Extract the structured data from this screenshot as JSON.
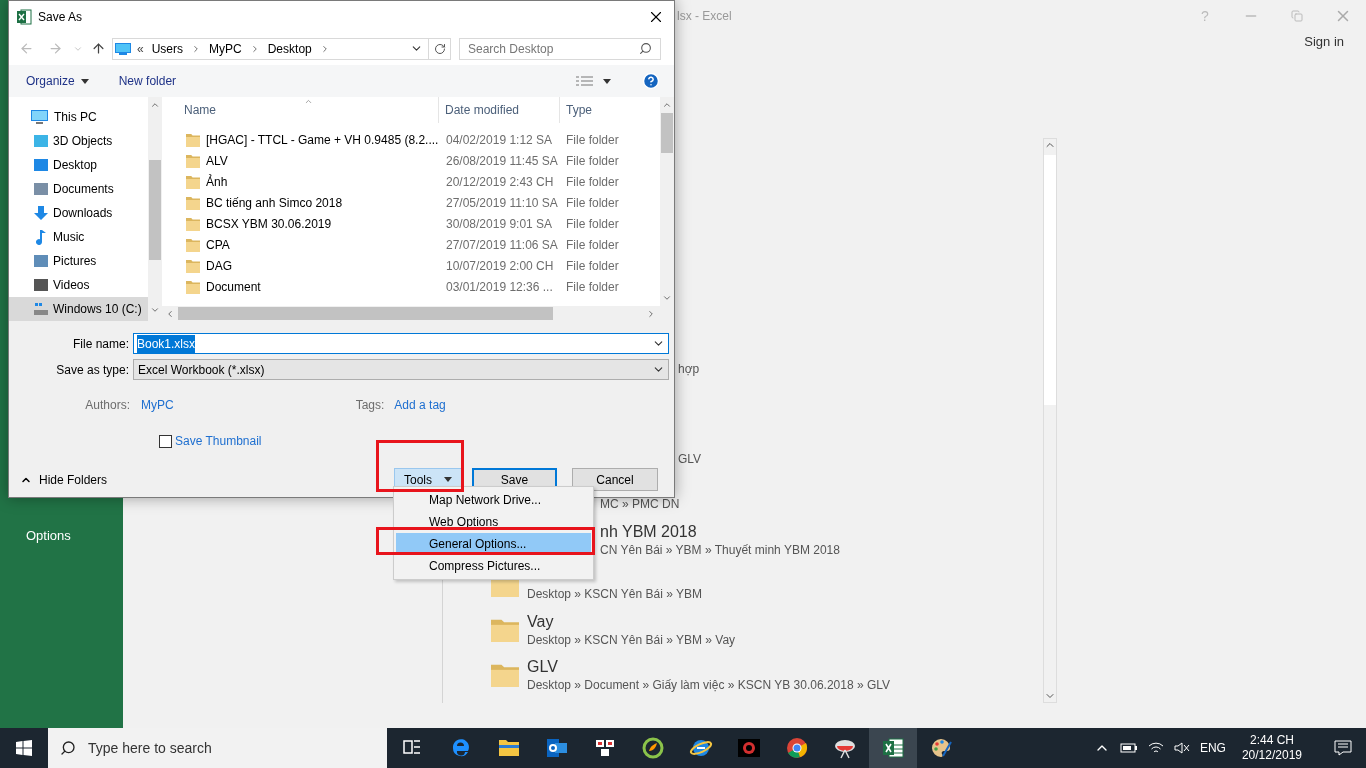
{
  "excel": {
    "title": "lsx - Excel",
    "window_controls": [
      "?"
    ],
    "sign_in": "Sign in",
    "sidebar": [
      {
        "label": "Options"
      }
    ],
    "recent": [
      {
        "kind": "edge",
        "path": "hợp"
      },
      {
        "kind": "edge",
        "path": "GLV"
      },
      {
        "kind": "tail",
        "path": "MC » PMC DN"
      },
      {
        "kind": "tail",
        "name": "nh YBM 2018",
        "path": "CN Yên Bái » YBM » Thuyết minh YBM 2018"
      },
      {
        "kind": "folder",
        "path": "Desktop » KSCN Yên Bái » YBM"
      },
      {
        "kind": "folder",
        "name": "Vay",
        "path": "Desktop » KSCN Yên Bái » YBM » Vay"
      },
      {
        "kind": "folder",
        "name": "GLV",
        "path": "Desktop » Document » Giấy làm việc » KSCN YB 30.06.2018 » GLV"
      }
    ]
  },
  "dialog": {
    "title": "Save As",
    "address": {
      "overflow": "«",
      "crumbs": [
        "Users",
        "MyPC",
        "Desktop"
      ]
    },
    "search": {
      "placeholder": "Search Desktop"
    },
    "commands": [
      "Organize",
      "New folder"
    ],
    "nav": [
      {
        "label": "This PC",
        "selected": false,
        "children": [
          {
            "label": "3D Objects",
            "selected": false
          },
          {
            "label": "Desktop",
            "selected": false
          },
          {
            "label": "Documents",
            "selected": false
          },
          {
            "label": "Downloads",
            "selected": false
          },
          {
            "label": "Music",
            "selected": false
          },
          {
            "label": "Pictures",
            "selected": false
          },
          {
            "label": "Videos",
            "selected": false
          },
          {
            "label": "Windows 10 (C:)",
            "selected": true
          }
        ]
      }
    ],
    "columns": [
      "Name",
      "Date modified",
      "Type"
    ],
    "rows": [
      {
        "name": "[HGAC] - TTCL - Game + VH  0.9485 (8.2....",
        "date": "04/02/2019 1:12 SA",
        "type": "File folder"
      },
      {
        "name": "ALV",
        "date": "26/08/2019 11:45 SA",
        "type": "File folder"
      },
      {
        "name": "Ảnh",
        "date": "20/12/2019 2:43 CH",
        "type": "File folder"
      },
      {
        "name": "BC tiếng anh Simco 2018",
        "date": "27/05/2019 11:10 SA",
        "type": "File folder"
      },
      {
        "name": "BCSX YBM 30.06.2019",
        "date": "30/08/2019 9:01 SA",
        "type": "File folder"
      },
      {
        "name": "CPA",
        "date": "27/07/2019 11:06 SA",
        "type": "File folder"
      },
      {
        "name": "DAG",
        "date": "10/07/2019 2:00 CH",
        "type": "File folder"
      },
      {
        "name": "Document",
        "date": "03/01/2019 12:36 ...",
        "type": "File folder"
      }
    ],
    "file_name": {
      "label": "File name:",
      "value": "Book1.xlsx",
      "value_selected": true
    },
    "save_type": {
      "label": "Save as type:",
      "value": "Excel Workbook (*.xlsx)"
    },
    "authors": {
      "label": "Authors:",
      "value": "MyPC"
    },
    "tags": {
      "label": "Tags:",
      "value": "Add a tag"
    },
    "thumbnail": {
      "label": "Save Thumbnail",
      "checked": false
    },
    "hide_folders": "Hide Folders",
    "tools": "Tools",
    "save": "Save",
    "cancel": "Cancel"
  },
  "menu": [
    {
      "label": "Map Network Drive...",
      "selected": false
    },
    {
      "label": "Web Options",
      "selected": false
    },
    {
      "label": "General Options...",
      "selected": true
    },
    {
      "label": "Compress Pictures...",
      "selected": false
    }
  ],
  "highlights": [
    {
      "kind": "frame"
    },
    {
      "kind": "frame"
    }
  ],
  "taskbar": {
    "search": {
      "placeholder": "Type here to search"
    },
    "apps": [
      {
        "selected": false
      },
      {
        "selected": false
      },
      {
        "selected": false
      },
      {
        "selected": false
      },
      {
        "selected": false
      },
      {
        "selected": false
      },
      {
        "selected": false
      },
      {
        "selected": false
      },
      {
        "selected": false
      },
      {
        "selected": false
      },
      {
        "selected": true
      },
      {
        "selected": false
      }
    ],
    "language": "ENG",
    "time": "2:44 CH",
    "date": "20/12/2019"
  }
}
